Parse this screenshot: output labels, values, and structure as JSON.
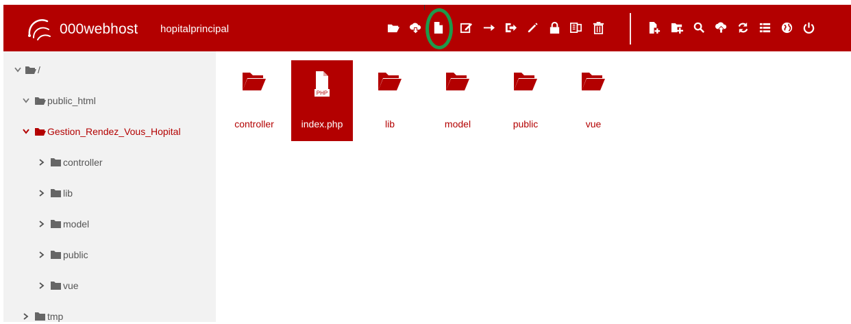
{
  "header": {
    "brand": "000webhost",
    "site_name": "hopitalprincipal",
    "toolbar": [
      {
        "icon": "folder-open-icon"
      },
      {
        "icon": "cloud-download-icon"
      },
      {
        "icon": "new-file-icon"
      },
      {
        "icon": "edit-icon"
      },
      {
        "icon": "arrow-right-icon"
      },
      {
        "icon": "move-icon"
      },
      {
        "icon": "pencil-icon"
      },
      {
        "icon": "lock-icon"
      },
      {
        "icon": "archive-icon"
      },
      {
        "icon": "trash-icon"
      },
      {
        "icon": "new-file-plus-icon"
      },
      {
        "icon": "new-folder-plus-icon"
      },
      {
        "icon": "search-icon"
      },
      {
        "icon": "cloud-upload-icon"
      },
      {
        "icon": "refresh-icon"
      },
      {
        "icon": "list-view-icon"
      },
      {
        "icon": "globe-icon"
      },
      {
        "icon": "power-icon"
      }
    ]
  },
  "sidebar": {
    "items": [
      {
        "label": "/",
        "expanded": true,
        "icon": "folder-open-icon"
      },
      {
        "label": "public_html",
        "expanded": true,
        "icon": "folder-open-icon"
      },
      {
        "label": "Gestion_Rendez_Vous_Hopital",
        "expanded": true,
        "active": true,
        "icon": "folder-open-icon"
      },
      {
        "label": "controller",
        "expanded": false,
        "icon": "folder-icon"
      },
      {
        "label": "lib",
        "expanded": false,
        "icon": "folder-icon"
      },
      {
        "label": "model",
        "expanded": false,
        "icon": "folder-icon"
      },
      {
        "label": "public",
        "expanded": false,
        "icon": "folder-icon"
      },
      {
        "label": "vue",
        "expanded": false,
        "icon": "folder-icon"
      },
      {
        "label": "tmp",
        "expanded": false,
        "icon": "folder-icon"
      }
    ]
  },
  "main": {
    "items": [
      {
        "name": "controller",
        "type": "folder",
        "icon": "folder-open-icon"
      },
      {
        "name": "index.php",
        "type": "file",
        "icon": "php-file-icon",
        "badge": "PHP",
        "selected": true
      },
      {
        "name": "lib",
        "type": "folder",
        "icon": "folder-open-icon"
      },
      {
        "name": "model",
        "type": "folder",
        "icon": "folder-open-icon"
      },
      {
        "name": "public",
        "type": "folder",
        "icon": "folder-open-icon"
      },
      {
        "name": "vue",
        "type": "folder",
        "icon": "folder-open-icon"
      }
    ]
  },
  "colors": {
    "brand_red": "#b30000",
    "highlight_green": "#1e9a4b",
    "sidebar_bg": "#f2f2f2"
  }
}
